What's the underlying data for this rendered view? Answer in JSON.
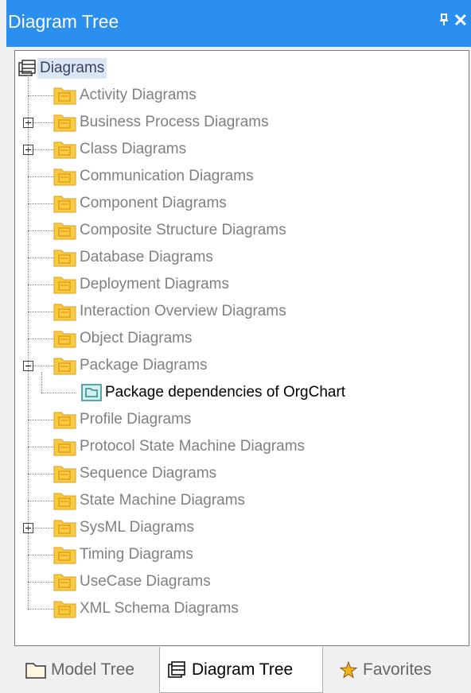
{
  "window": {
    "title": "Diagram Tree"
  },
  "tree": {
    "root": {
      "label": "Diagrams"
    },
    "items": [
      {
        "label": "Activity Diagrams",
        "icon": "activity-diagram-icon",
        "expander": "none"
      },
      {
        "label": "Business Process Diagrams",
        "icon": "business-process-diagram-icon",
        "expander": "plus"
      },
      {
        "label": "Class Diagrams",
        "icon": "class-diagram-icon",
        "expander": "plus"
      },
      {
        "label": "Communication Diagrams",
        "icon": "communication-diagram-icon",
        "expander": "none"
      },
      {
        "label": "Component Diagrams",
        "icon": "component-diagram-icon",
        "expander": "none"
      },
      {
        "label": "Composite Structure Diagrams",
        "icon": "composite-structure-diagram-icon",
        "expander": "none"
      },
      {
        "label": "Database Diagrams",
        "icon": "database-diagram-icon",
        "expander": "none"
      },
      {
        "label": "Deployment Diagrams",
        "icon": "deployment-diagram-icon",
        "expander": "none"
      },
      {
        "label": "Interaction Overview Diagrams",
        "icon": "interaction-overview-diagram-icon",
        "expander": "none"
      },
      {
        "label": "Object Diagrams",
        "icon": "object-diagram-icon",
        "expander": "none"
      },
      {
        "label": "Package Diagrams",
        "icon": "package-diagram-icon",
        "expander": "minus",
        "children": [
          {
            "label": "Package dependencies of OrgChart",
            "icon": "package-diagram-file-icon"
          }
        ]
      },
      {
        "label": "Profile Diagrams",
        "icon": "profile-diagram-icon",
        "expander": "none"
      },
      {
        "label": "Protocol State Machine Diagrams",
        "icon": "protocol-state-machine-diagram-icon",
        "expander": "none"
      },
      {
        "label": "Sequence Diagrams",
        "icon": "sequence-diagram-icon",
        "expander": "none"
      },
      {
        "label": "State Machine Diagrams",
        "icon": "state-machine-diagram-icon",
        "expander": "none"
      },
      {
        "label": "SysML Diagrams",
        "icon": "sysml-diagram-icon",
        "expander": "plus"
      },
      {
        "label": "Timing Diagrams",
        "icon": "timing-diagram-icon",
        "expander": "none"
      },
      {
        "label": "UseCase Diagrams",
        "icon": "usecase-diagram-icon",
        "expander": "none"
      },
      {
        "label": "XML Schema Diagrams",
        "icon": "xml-schema-diagram-icon",
        "expander": "none"
      }
    ]
  },
  "bottom_tabs": [
    {
      "label": "Model Tree",
      "icon": "model-tree-icon",
      "active": false
    },
    {
      "label": "Diagram Tree",
      "icon": "diagram-tree-icon",
      "active": true
    },
    {
      "label": "Favorites",
      "icon": "favorites-icon",
      "active": false
    }
  ],
  "colors": {
    "titlebar": "#2b8ff0",
    "folder_fill": "#f9cb3e",
    "folder_stroke": "#e09b1c",
    "selection": "#d8e6f6"
  }
}
